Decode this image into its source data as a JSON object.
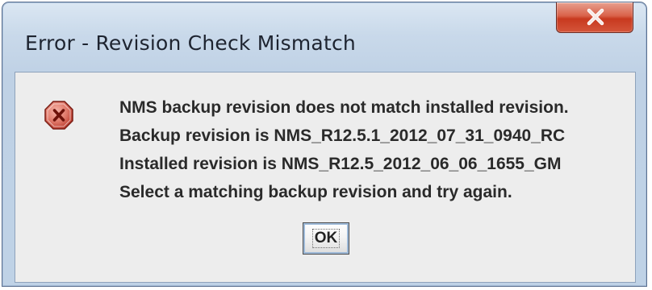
{
  "dialog": {
    "title": "Error - Revision Check Mismatch",
    "close_icon": "close-x-icon",
    "icon": "error-stop-icon",
    "message_lines": [
      "NMS backup revision does not match installed revision.",
      "Backup revision is NMS_R12.5.1_2012_07_31_0940_RC",
      "Installed revision is NMS_R12.5_2012_06_06_1655_GM",
      "Select a matching backup revision and try again."
    ],
    "ok_label": "OK"
  },
  "colors": {
    "close_button": "#c8391f",
    "error_icon": "#c0392b",
    "panel_background": "#ededed",
    "frame": "#bfd1e5"
  }
}
